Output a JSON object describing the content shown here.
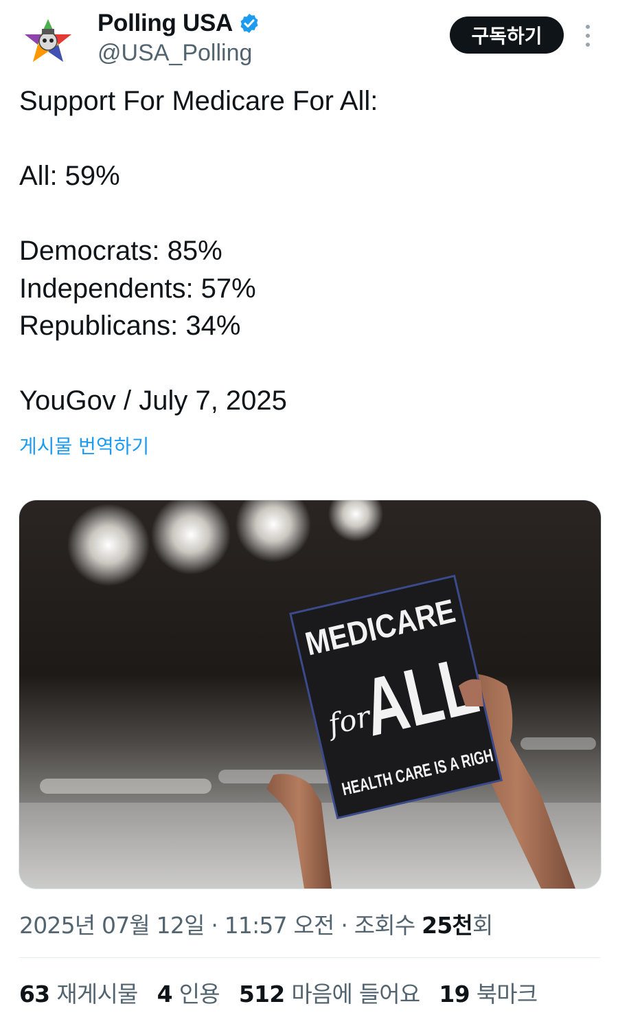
{
  "author": {
    "name": "Polling USA",
    "handle": "@USA_Polling",
    "verified": true
  },
  "actions": {
    "subscribe_label": "구독하기",
    "more_icon": "more-vertical-icon"
  },
  "post": {
    "lines": [
      "Support For Medicare For All:",
      "",
      "All: 59%",
      "",
      "Democrats: 85%",
      "Independents: 57%",
      "Republicans: 34%",
      "",
      "YouGov / July 7, 2025"
    ],
    "translate_label": "게시물 번역하기"
  },
  "media": {
    "sign_line1": "MEDICARE",
    "sign_for": "for",
    "sign_line2": "ALL",
    "sign_line3": "HEALTH CARE IS A RIGH"
  },
  "meta": {
    "date": "2025년 07월 12일",
    "sep1": " · ",
    "time": "11:57 오전",
    "sep2": " · ",
    "views_label": "조회수 ",
    "views_value": "25천",
    "views_suffix": "회"
  },
  "stats": [
    {
      "value": "63",
      "label": "재게시물"
    },
    {
      "value": "4",
      "label": "인용"
    },
    {
      "value": "512",
      "label": "마음에 들어요"
    },
    {
      "value": "19",
      "label": "북마크"
    }
  ],
  "colors": {
    "accent": "#1d9bf0",
    "text": "#0f1419",
    "muted": "#536471",
    "button": "#0f1419"
  }
}
